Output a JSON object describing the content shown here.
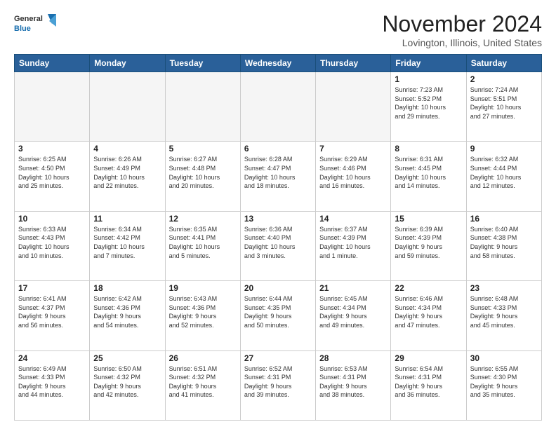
{
  "logo": {
    "general": "General",
    "blue": "Blue"
  },
  "header": {
    "month": "November 2024",
    "location": "Lovington, Illinois, United States"
  },
  "weekdays": [
    "Sunday",
    "Monday",
    "Tuesday",
    "Wednesday",
    "Thursday",
    "Friday",
    "Saturday"
  ],
  "weeks": [
    [
      {
        "day": "",
        "info": "",
        "empty": true
      },
      {
        "day": "",
        "info": "",
        "empty": true
      },
      {
        "day": "",
        "info": "",
        "empty": true
      },
      {
        "day": "",
        "info": "",
        "empty": true
      },
      {
        "day": "",
        "info": "",
        "empty": true
      },
      {
        "day": "1",
        "info": "Sunrise: 7:23 AM\nSunset: 5:52 PM\nDaylight: 10 hours\nand 29 minutes."
      },
      {
        "day": "2",
        "info": "Sunrise: 7:24 AM\nSunset: 5:51 PM\nDaylight: 10 hours\nand 27 minutes."
      }
    ],
    [
      {
        "day": "3",
        "info": "Sunrise: 6:25 AM\nSunset: 4:50 PM\nDaylight: 10 hours\nand 25 minutes."
      },
      {
        "day": "4",
        "info": "Sunrise: 6:26 AM\nSunset: 4:49 PM\nDaylight: 10 hours\nand 22 minutes."
      },
      {
        "day": "5",
        "info": "Sunrise: 6:27 AM\nSunset: 4:48 PM\nDaylight: 10 hours\nand 20 minutes."
      },
      {
        "day": "6",
        "info": "Sunrise: 6:28 AM\nSunset: 4:47 PM\nDaylight: 10 hours\nand 18 minutes."
      },
      {
        "day": "7",
        "info": "Sunrise: 6:29 AM\nSunset: 4:46 PM\nDaylight: 10 hours\nand 16 minutes."
      },
      {
        "day": "8",
        "info": "Sunrise: 6:31 AM\nSunset: 4:45 PM\nDaylight: 10 hours\nand 14 minutes."
      },
      {
        "day": "9",
        "info": "Sunrise: 6:32 AM\nSunset: 4:44 PM\nDaylight: 10 hours\nand 12 minutes."
      }
    ],
    [
      {
        "day": "10",
        "info": "Sunrise: 6:33 AM\nSunset: 4:43 PM\nDaylight: 10 hours\nand 10 minutes."
      },
      {
        "day": "11",
        "info": "Sunrise: 6:34 AM\nSunset: 4:42 PM\nDaylight: 10 hours\nand 7 minutes."
      },
      {
        "day": "12",
        "info": "Sunrise: 6:35 AM\nSunset: 4:41 PM\nDaylight: 10 hours\nand 5 minutes."
      },
      {
        "day": "13",
        "info": "Sunrise: 6:36 AM\nSunset: 4:40 PM\nDaylight: 10 hours\nand 3 minutes."
      },
      {
        "day": "14",
        "info": "Sunrise: 6:37 AM\nSunset: 4:39 PM\nDaylight: 10 hours\nand 1 minute."
      },
      {
        "day": "15",
        "info": "Sunrise: 6:39 AM\nSunset: 4:39 PM\nDaylight: 9 hours\nand 59 minutes."
      },
      {
        "day": "16",
        "info": "Sunrise: 6:40 AM\nSunset: 4:38 PM\nDaylight: 9 hours\nand 58 minutes."
      }
    ],
    [
      {
        "day": "17",
        "info": "Sunrise: 6:41 AM\nSunset: 4:37 PM\nDaylight: 9 hours\nand 56 minutes."
      },
      {
        "day": "18",
        "info": "Sunrise: 6:42 AM\nSunset: 4:36 PM\nDaylight: 9 hours\nand 54 minutes."
      },
      {
        "day": "19",
        "info": "Sunrise: 6:43 AM\nSunset: 4:36 PM\nDaylight: 9 hours\nand 52 minutes."
      },
      {
        "day": "20",
        "info": "Sunrise: 6:44 AM\nSunset: 4:35 PM\nDaylight: 9 hours\nand 50 minutes."
      },
      {
        "day": "21",
        "info": "Sunrise: 6:45 AM\nSunset: 4:34 PM\nDaylight: 9 hours\nand 49 minutes."
      },
      {
        "day": "22",
        "info": "Sunrise: 6:46 AM\nSunset: 4:34 PM\nDaylight: 9 hours\nand 47 minutes."
      },
      {
        "day": "23",
        "info": "Sunrise: 6:48 AM\nSunset: 4:33 PM\nDaylight: 9 hours\nand 45 minutes."
      }
    ],
    [
      {
        "day": "24",
        "info": "Sunrise: 6:49 AM\nSunset: 4:33 PM\nDaylight: 9 hours\nand 44 minutes."
      },
      {
        "day": "25",
        "info": "Sunrise: 6:50 AM\nSunset: 4:32 PM\nDaylight: 9 hours\nand 42 minutes."
      },
      {
        "day": "26",
        "info": "Sunrise: 6:51 AM\nSunset: 4:32 PM\nDaylight: 9 hours\nand 41 minutes."
      },
      {
        "day": "27",
        "info": "Sunrise: 6:52 AM\nSunset: 4:31 PM\nDaylight: 9 hours\nand 39 minutes."
      },
      {
        "day": "28",
        "info": "Sunrise: 6:53 AM\nSunset: 4:31 PM\nDaylight: 9 hours\nand 38 minutes."
      },
      {
        "day": "29",
        "info": "Sunrise: 6:54 AM\nSunset: 4:31 PM\nDaylight: 9 hours\nand 36 minutes."
      },
      {
        "day": "30",
        "info": "Sunrise: 6:55 AM\nSunset: 4:30 PM\nDaylight: 9 hours\nand 35 minutes."
      }
    ]
  ]
}
